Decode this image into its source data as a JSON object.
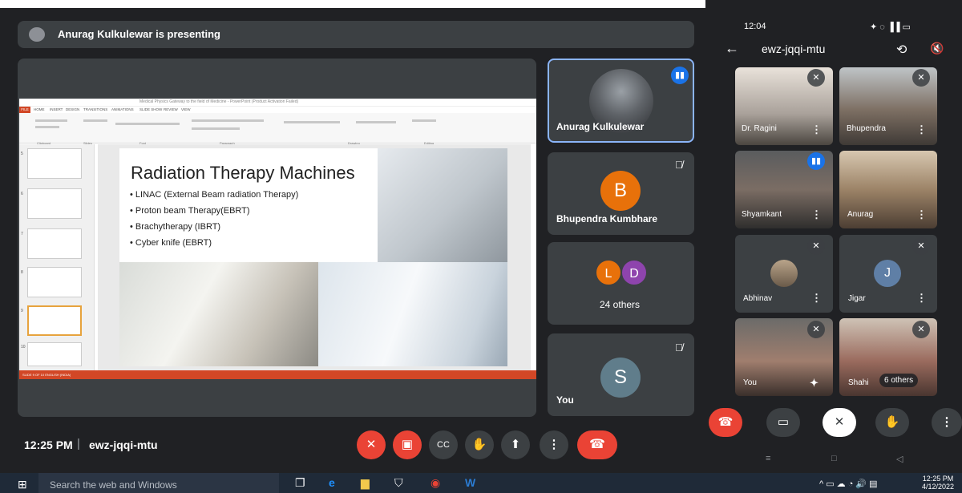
{
  "presenting_banner": "Anurag Kulkulewar is presenting",
  "ppt": {
    "window_title": "Medical Physics Gateway to the field of Medicine - PowerPoint (Product Activation Failed)",
    "file_tab": "FILE",
    "tabs": [
      "HOME",
      "INSERT",
      "DESIGN",
      "TRANSITIONS",
      "ANIMATIONS",
      "SLIDE SHOW",
      "REVIEW",
      "VIEW"
    ],
    "groups": [
      "Clipboard",
      "Slides",
      "Font",
      "Paragraph",
      "Drawing",
      "Editing"
    ],
    "slide_numbers": [
      "5",
      "6",
      "7",
      "8",
      "9",
      "10"
    ],
    "status_text": "SLIDE 9 OF 10    ENGLISH (INDIA)"
  },
  "slide": {
    "title": "Radiation Therapy Machines",
    "bullets": [
      "• LINAC (External Beam radiation Therapy)",
      "• Proton beam Therapy(EBRT)",
      "• Brachytherapy (IBRT)",
      "• Cyber knife (EBRT)"
    ]
  },
  "tiles": {
    "anurag": {
      "name": "Anurag Kulkulewar"
    },
    "bhupendra": {
      "name": "Bhupendra Kumbhare",
      "initial": "B",
      "color": "#e8710a"
    },
    "others": {
      "label": "24 others",
      "initials": [
        "L",
        "D"
      ],
      "colors": [
        "#e8710a",
        "#8e44ad"
      ]
    },
    "you": {
      "name": "You",
      "initial": "S",
      "color": "#607d8b"
    }
  },
  "controls": {
    "time": "12:25 PM",
    "separator": "|",
    "meeting_code": "ewz-jqqi-mtu",
    "mic_icon": "mic-off-icon",
    "cam_icon": "camera-off-icon",
    "cc_icon": "captions-icon",
    "hand_icon": "raise-hand-icon",
    "present_icon": "present-icon",
    "more_icon": "more-icon",
    "end_icon": "end-call-icon"
  },
  "taskbar": {
    "search_placeholder": "Search the web and Windows",
    "clock_time": "12:25 PM",
    "clock_date": "4/12/2022"
  },
  "phone": {
    "status_time": "12:04",
    "meeting_code": "ewz-jqqi-mtu",
    "participants": [
      {
        "name": "Dr. Ragini"
      },
      {
        "name": "Bhupendra"
      },
      {
        "name": "Shyamkant"
      },
      {
        "name": "Anurag"
      },
      {
        "name": "Abhinav"
      },
      {
        "name": "Jigar",
        "initial": "J"
      },
      {
        "name": "You"
      },
      {
        "name": "Shahi",
        "extra": "6 others"
      }
    ]
  }
}
